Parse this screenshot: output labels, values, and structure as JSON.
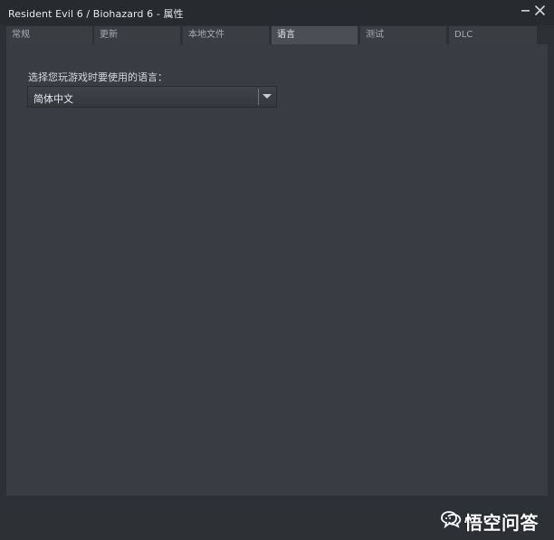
{
  "window": {
    "title": "Resident Evil 6 / Biohazard 6 - 属性"
  },
  "window_controls": {
    "minimize": "minimize-icon",
    "close": "close-icon"
  },
  "tabs": [
    {
      "label": "常规",
      "active": false
    },
    {
      "label": "更新",
      "active": false
    },
    {
      "label": "本地文件",
      "active": false
    },
    {
      "label": "语言",
      "active": true
    },
    {
      "label": "测试",
      "active": false
    },
    {
      "label": "DLC",
      "active": false
    }
  ],
  "language": {
    "label": "选择您玩游戏时要使用的语言：",
    "selected": "简体中文"
  },
  "watermark": {
    "text": "悟空问答"
  },
  "colors": {
    "background": "#2d3035",
    "panel": "#393c42",
    "tab": "#3a3d42",
    "tab_active": "#4b4f55",
    "text": "#e8ecef"
  }
}
